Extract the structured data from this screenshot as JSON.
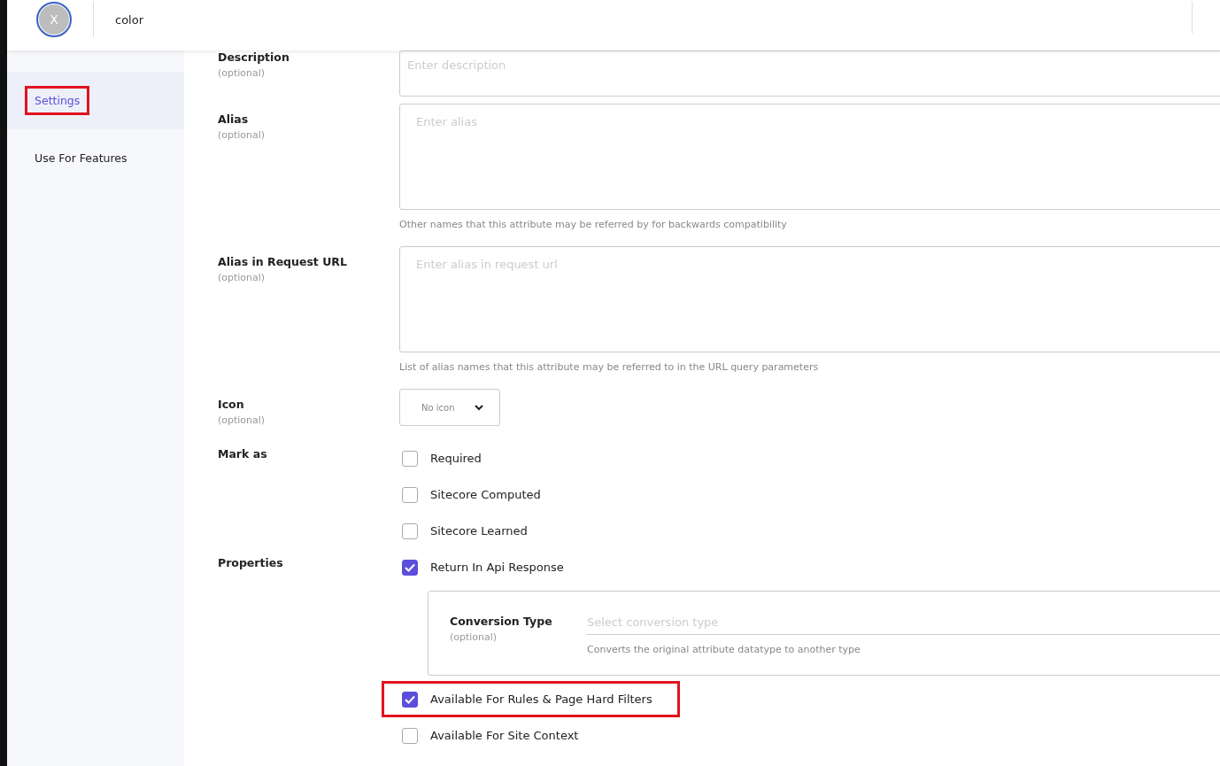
{
  "header": {
    "avatar_letter": "X",
    "title": "color"
  },
  "sidebar": {
    "items": [
      {
        "label": "Settings",
        "selected": true,
        "highlighted": true
      },
      {
        "label": "Use For Features",
        "selected": false,
        "highlighted": false
      }
    ]
  },
  "fields": [
    {
      "kind": "input",
      "label": "Description",
      "note": "(optional)",
      "placeholder": "Enter description"
    },
    {
      "kind": "textarea",
      "label": "Alias",
      "note": "(optional)",
      "placeholder": "Enter alias",
      "help": "Other names that this attribute may be referred by for backwards compatibility"
    },
    {
      "kind": "textarea",
      "label": "Alias in Request URL",
      "note": "(optional)",
      "placeholder": "Enter alias in request url",
      "help": "List of alias names that this attribute may be referred to in the URL query parameters"
    },
    {
      "kind": "select",
      "label": "Icon",
      "note": "(optional)",
      "value": "No icon"
    },
    {
      "kind": "checkboxes",
      "label": "Mark as",
      "options": [
        {
          "label": "Required",
          "checked": false,
          "highlighted": false
        },
        {
          "label": "Sitecore Computed",
          "checked": false,
          "highlighted": false
        },
        {
          "label": "Sitecore Learned",
          "checked": false,
          "highlighted": false
        }
      ]
    },
    {
      "kind": "checkboxes",
      "label": "Properties",
      "options": [
        {
          "label": "Return In Api Response",
          "checked": true,
          "highlighted": false,
          "sub": {
            "label": "Conversion Type",
            "note": "(optional)",
            "placeholder": "Select conversion type",
            "help": "Converts the original attribute datatype to another type"
          }
        },
        {
          "label": "Available For Rules & Page Hard Filters",
          "checked": true,
          "highlighted": true
        },
        {
          "label": "Available For Site Context",
          "checked": false,
          "highlighted": false
        }
      ]
    }
  ]
}
